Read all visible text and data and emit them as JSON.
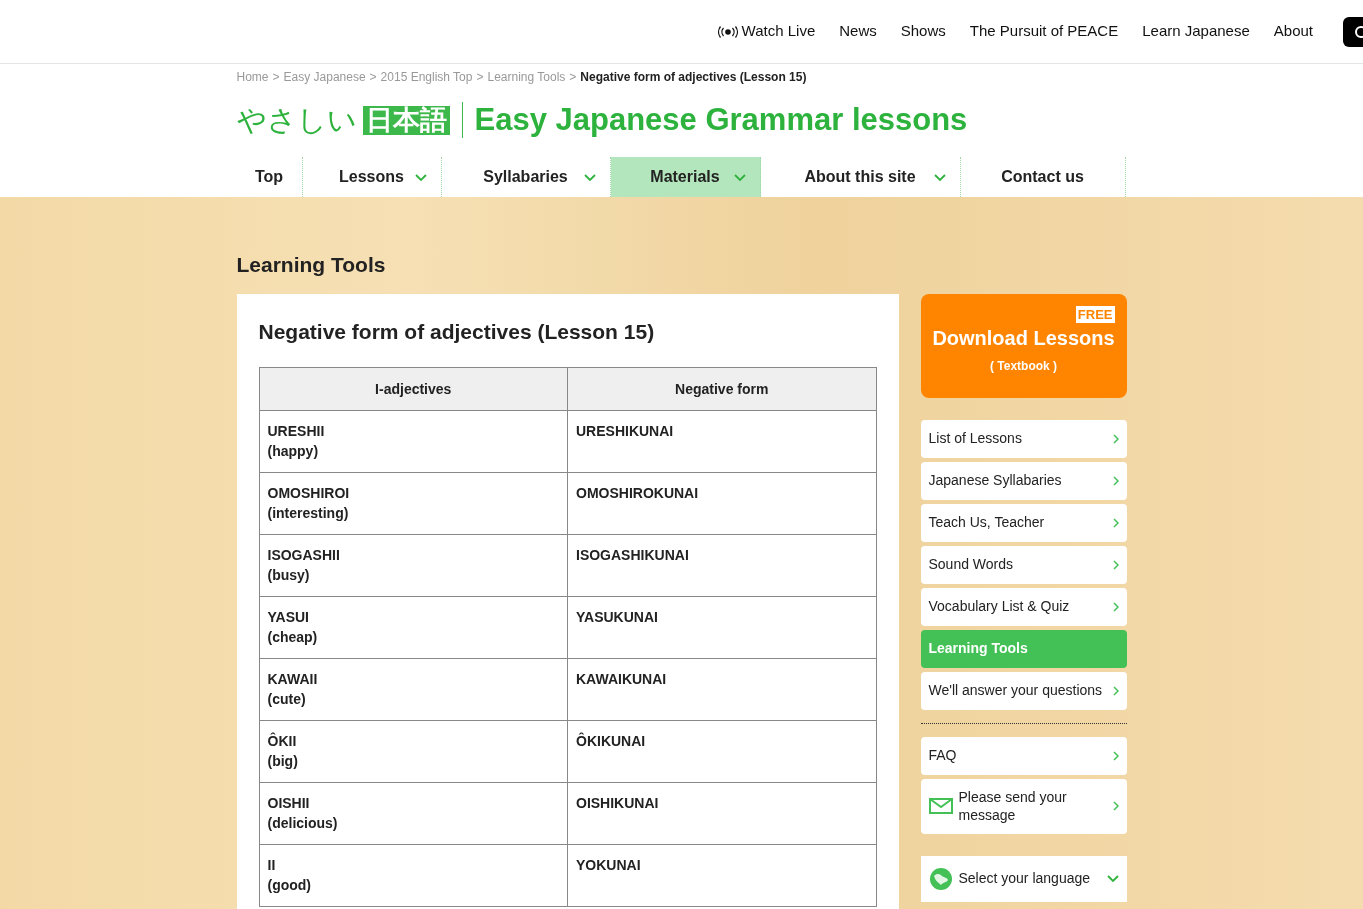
{
  "top_nav": [
    {
      "label": "Watch Live",
      "kind": "live"
    },
    {
      "label": "News",
      "kind": "link"
    },
    {
      "label": "Shows",
      "kind": "link"
    },
    {
      "label": "The Pursuit of PEACE",
      "kind": "link"
    },
    {
      "label": "Learn Japanese",
      "kind": "link"
    },
    {
      "label": "About",
      "kind": "link"
    }
  ],
  "breadcrumb": [
    {
      "label": "Home",
      "current": false
    },
    {
      "label": "Easy Japanese",
      "current": false
    },
    {
      "label": "2015 English Top",
      "current": false
    },
    {
      "label": "Learning Tools",
      "current": false
    },
    {
      "label": "Negative form of adjectives (Lesson 15)",
      "current": true
    }
  ],
  "breadcrumb_separator": ">",
  "logo": {
    "kana": "やさしい",
    "kanji": "日本語",
    "title": "Easy Japanese Grammar lessons"
  },
  "main_nav": [
    {
      "label": "Top",
      "dropdown": false,
      "selected": false
    },
    {
      "label": "Lessons",
      "dropdown": true,
      "selected": false
    },
    {
      "label": "Syllabaries",
      "dropdown": true,
      "selected": false
    },
    {
      "label": "Materials",
      "dropdown": true,
      "selected": true
    },
    {
      "label": "About this site",
      "dropdown": true,
      "selected": false
    },
    {
      "label": "Contact us",
      "dropdown": false,
      "selected": false
    }
  ],
  "section_title": "Learning Tools",
  "article": {
    "title": "Negative form of adjectives (Lesson 15)",
    "columns": [
      "I-adjectives",
      "Negative form"
    ],
    "rows": [
      {
        "adjective": "URESHII",
        "meaning": "(happy)",
        "negative": "URESHIKUNAI"
      },
      {
        "adjective": "OMOSHIROI",
        "meaning": "(interesting)",
        "negative": "OMOSHIROKUNAI"
      },
      {
        "adjective": "ISOGASHII",
        "meaning": "(busy)",
        "negative": "ISOGASHIKUNAI"
      },
      {
        "adjective": "YASUI",
        "meaning": "(cheap)",
        "negative": "YASUKUNAI"
      },
      {
        "adjective": "KAWAII",
        "meaning": "(cute)",
        "negative": "KAWAIKUNAI"
      },
      {
        "adjective": "ÔKII",
        "meaning": "(big)",
        "negative": "ÔKIKUNAI"
      },
      {
        "adjective": "OISHII",
        "meaning": "(delicious)",
        "negative": "OISHIKUNAI"
      },
      {
        "adjective": "II",
        "meaning": "(good)",
        "negative": "YOKUNAI"
      }
    ]
  },
  "download": {
    "badge": "FREE",
    "title": "Download Lessons",
    "subtitle": "( Textbook )"
  },
  "sidebar_menu": [
    {
      "label": "List of Lessons",
      "selected": false
    },
    {
      "label": "Japanese Syllabaries",
      "selected": false
    },
    {
      "label": "Teach Us, Teacher",
      "selected": false
    },
    {
      "label": "Sound Words",
      "selected": false
    },
    {
      "label": "Vocabulary List & Quiz",
      "selected": false
    },
    {
      "label": "Learning Tools",
      "selected": true
    },
    {
      "label": "We'll answer your questions",
      "selected": false
    }
  ],
  "support_menu": [
    {
      "label": "FAQ",
      "kind": "plain"
    },
    {
      "label": "Please send your message",
      "kind": "mail"
    }
  ],
  "language_select": {
    "label": "Select your language"
  }
}
